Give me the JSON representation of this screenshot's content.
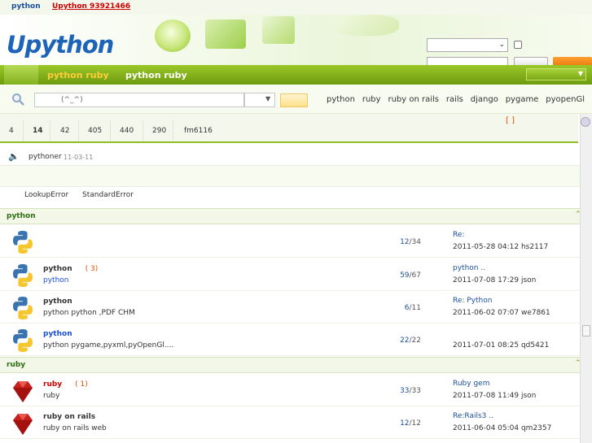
{
  "topbar": {
    "link1": "python",
    "link2": "Upython  93921466"
  },
  "logo": {
    "text": "Upython"
  },
  "nav": {
    "item1": "python ruby",
    "item2": "python ruby"
  },
  "search": {
    "value": "(^_^)",
    "tags": [
      "python",
      "ruby",
      "ruby on rails",
      "rails",
      "django",
      "pygame",
      "pyopenGl"
    ]
  },
  "stats": [
    "4",
    "14",
    "42",
    "405",
    "440",
    "290",
    "fm6116"
  ],
  "bracket": "[   ]",
  "announcement": {
    "user": "pythoner",
    "date": "11-03-11"
  },
  "errors": [
    "LookupError",
    "StandardError"
  ],
  "sections": [
    {
      "title": "python",
      "rows": [
        {
          "name": "",
          "count": "",
          "desc": "",
          "stat_a": "12",
          "stat_b": "/34",
          "last1": "Re:",
          "last2": "2011-05-28 04:12 hs2117"
        },
        {
          "name": "python",
          "count": "( 3)",
          "desc": "python",
          "stat_a": "59",
          "stat_b": "/67",
          "last1": "python      ..",
          "last2": "2011-07-08 17:29 json"
        },
        {
          "name": "python",
          "count": "",
          "desc": "python          python   ,PDF CHM",
          "stat_a": "6",
          "stat_b": "/11",
          "last1": "Re:  Python",
          "last2": "2011-06-02 07:07 we7861"
        },
        {
          "name": "python",
          "count": "",
          "desc": " python     pygame,pyxml,pyOpenGl....",
          "stat_a": "22",
          "stat_b": "/22",
          "last1": "",
          "last2": "2011-07-01 08:25 qd5421"
        }
      ]
    },
    {
      "title": "ruby",
      "rows": [
        {
          "name": "ruby",
          "count": "( 1)",
          "desc": "ruby",
          "stat_a": "33",
          "stat_b": "/33",
          "last1": "Ruby gem",
          "last2": "2011-07-08 11:49 json"
        },
        {
          "name": "ruby on rails",
          "count": "",
          "desc": "ruby on rails   web",
          "stat_a": "12",
          "stat_b": "/12",
          "last1": "Re:Rails3      ..",
          "last2": "2011-06-04 05:04 qm2357"
        }
      ]
    }
  ],
  "colors": {
    "brand": "#1d63b8",
    "nav": "#8cbf26",
    "accent": "#e05000"
  }
}
